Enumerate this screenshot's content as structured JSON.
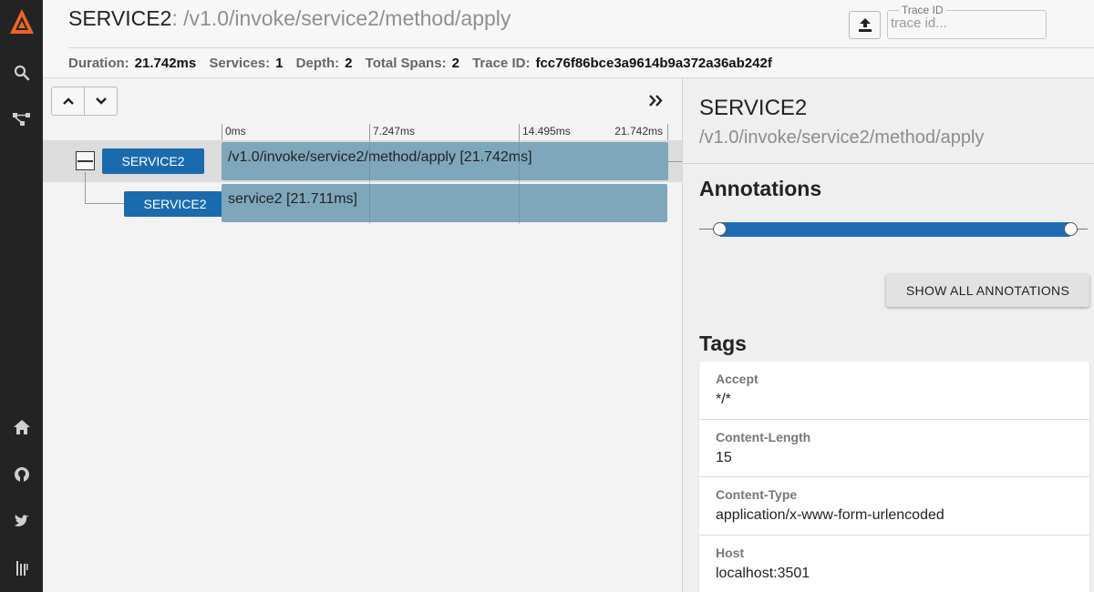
{
  "header": {
    "service": "SERVICE2",
    "separator": ":",
    "span_name": " /v1.0/invoke/service2/method/apply",
    "summary": [
      {
        "label": "Duration:",
        "value": "21.742ms"
      },
      {
        "label": "Services:",
        "value": "1"
      },
      {
        "label": "Depth:",
        "value": "2"
      },
      {
        "label": "Total Spans:",
        "value": "2"
      },
      {
        "label": "Trace ID:",
        "value": "fcc76f86bce3a9614b9a372a36ab242f"
      }
    ],
    "trace_id_legend": "Trace ID",
    "trace_id_placeholder": "trace id..."
  },
  "sidebar": {
    "top_icons": [
      "logo-icon",
      "search-icon",
      "dependencies-icon"
    ],
    "bottom_icons": [
      "home-icon",
      "github-icon",
      "twitter-icon",
      "gitter-icon"
    ]
  },
  "timeline": {
    "ticks": [
      "0ms",
      "7.247ms",
      "14.495ms",
      "21.742ms"
    ],
    "spans": [
      {
        "service": "SERVICE2",
        "label": "/v1.0/invoke/service2/method/apply [21.742ms]",
        "depth": 0,
        "duration_ms": 21.742
      },
      {
        "service": "SERVICE2",
        "label": "service2 [21.711ms]",
        "depth": 1,
        "duration_ms": 21.711
      }
    ]
  },
  "detail": {
    "service": "SERVICE2",
    "span_name": "/v1.0/invoke/service2/method/apply",
    "annotations_title": "Annotations",
    "show_all_label": "SHOW ALL ANNOTATIONS",
    "tags_title": "Tags",
    "tags": [
      {
        "key": "Accept",
        "value": "*/*"
      },
      {
        "key": "Content-Length",
        "value": "15"
      },
      {
        "key": "Content-Type",
        "value": "application/x-www-form-urlencoded"
      },
      {
        "key": "Host",
        "value": "localhost:3501"
      }
    ]
  },
  "colors": {
    "sidebar_bg": "#232323",
    "logo_orange": "#f0661e",
    "service_badge": "#1a6bae",
    "span_bar": "#7fa7bc",
    "annotation_bar": "#1d6cb4"
  }
}
